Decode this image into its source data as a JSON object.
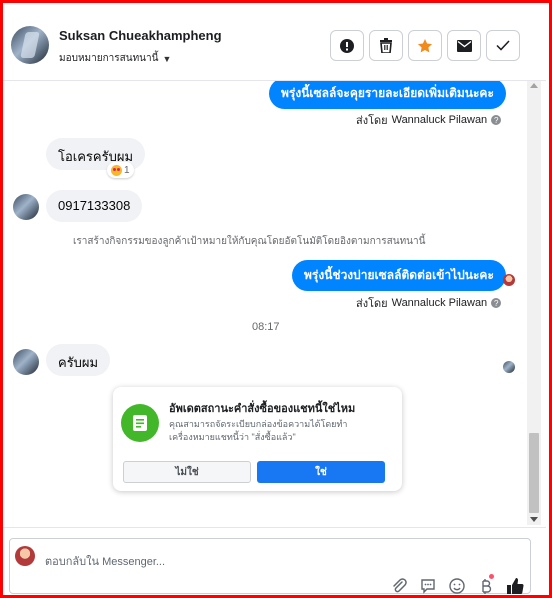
{
  "header": {
    "contact_name": "Suksan Chueakhampheng",
    "assign_label": "มอบหมายการสนทนานี้",
    "buttons": [
      "mark-spam",
      "delete",
      "star",
      "mark-unread",
      "mark-done"
    ]
  },
  "messages": [
    {
      "dir": "out",
      "text": "พรุ่งนี้เซลล์จะคุยรายละเอียดเพิ่มเติมนะคะ",
      "sent_by_prefix": "ส่งโดย",
      "sent_by_name": "Wannaluck Pilawan"
    },
    {
      "dir": "in",
      "text": "โอเครครับผม",
      "reaction_count": "1"
    },
    {
      "dir": "in",
      "text": "0917133308"
    },
    {
      "dir": "system",
      "text": "เราสร้างกิจกรรมของลูกค้าเป้าหมายให้กับคุณโดยอัตโนมัติโดยอิงตามการสนทนานี้"
    },
    {
      "dir": "out",
      "text": "พรุ่งนี้ช่วงบ่ายเซลล์ติดต่อเข้าไปนะคะ",
      "sent_by_prefix": "ส่งโดย",
      "sent_by_name": "Wannaluck Pilawan"
    },
    {
      "dir": "time",
      "text": "08:17"
    },
    {
      "dir": "in",
      "text": "ครับผม"
    }
  ],
  "order_card": {
    "title": "อัพเดตสถานะคำสั่งซื้อของแชทนี้ใช่ไหม",
    "body": "คุณสามารถจัดระเบียบกล่องข้อความได้โดยทำเครื่องหมายแชทนี้ว่า \"สั่งซื้อแล้ว\"",
    "no_label": "ไม่ใช่",
    "yes_label": "ใช่"
  },
  "composer": {
    "placeholder": "ตอบกลับใน Messenger..."
  },
  "colors": {
    "brand_blue": "#0084ff",
    "button_blue": "#1877f2",
    "card_icon_green": "#42b72a",
    "frame_red": "#ff0000"
  }
}
